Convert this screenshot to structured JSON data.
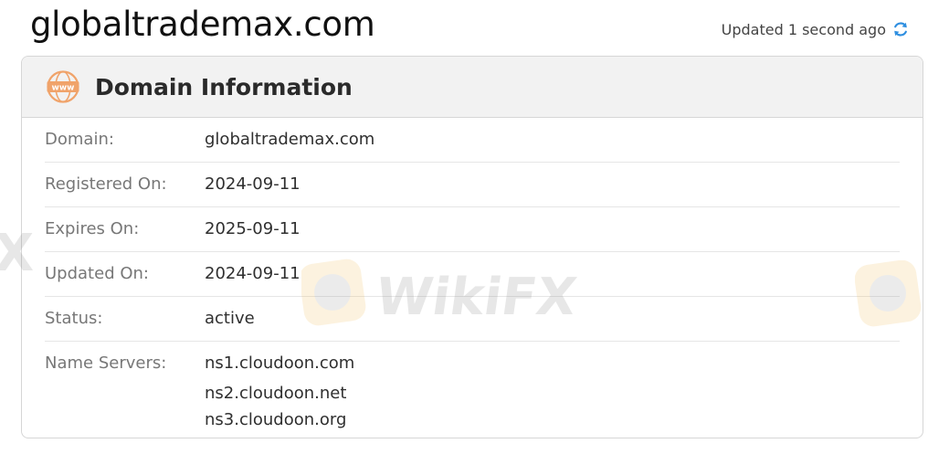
{
  "header": {
    "site_title": "globaltrademax.com",
    "updated_text": "Updated 1 second ago",
    "refresh_icon": "refresh-icon"
  },
  "card": {
    "icon": "www-icon",
    "icon_text": "www",
    "title": "Domain Information",
    "rows": [
      {
        "label": "Domain:",
        "value": "globaltrademax.com"
      },
      {
        "label": "Registered On:",
        "value": "2024-09-11"
      },
      {
        "label": "Expires On:",
        "value": "2025-09-11"
      },
      {
        "label": "Updated On:",
        "value": "2024-09-11"
      },
      {
        "label": "Status:",
        "value": "active"
      }
    ],
    "name_servers": {
      "label": "Name Servers:",
      "values": [
        "ns1.cloudoon.com",
        "ns2.cloudoon.net",
        "ns3.cloudoon.org"
      ]
    }
  },
  "watermark": {
    "text": "WikiFX"
  },
  "colors": {
    "accent_orange": "#f0a36a",
    "refresh_blue": "#2f8fe0",
    "header_bg": "#f2f2f2",
    "border": "#d6d6d6"
  }
}
